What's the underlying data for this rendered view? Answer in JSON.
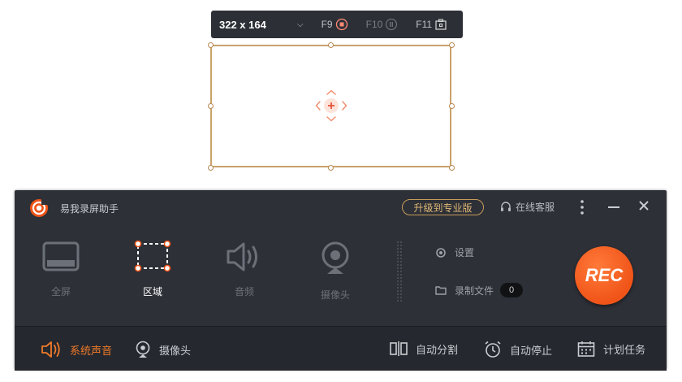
{
  "selection": {
    "size": "322 x 164",
    "hotkeys": [
      {
        "key": "F9",
        "icon": "stop-record-icon"
      },
      {
        "key": "F10",
        "icon": "pause-icon"
      },
      {
        "key": "F11",
        "icon": "screenshot-icon"
      }
    ]
  },
  "app": {
    "title": "易我录屏助手",
    "upgrade_label": "升级到专业版",
    "support_label": "在线客服"
  },
  "modes": [
    {
      "label": "全屏",
      "icon": "monitor-icon",
      "active": false
    },
    {
      "label": "区域",
      "icon": "region-select-icon",
      "active": true
    },
    {
      "label": "音频",
      "icon": "speaker-icon",
      "active": false
    },
    {
      "label": "摄像头",
      "icon": "webcam-icon",
      "active": false
    }
  ],
  "side": {
    "settings_label": "设置",
    "files_label": "录制文件",
    "files_count": "0"
  },
  "rec_label": "REC",
  "bottom": {
    "system_sound": "系统声音",
    "camera": "摄像头",
    "auto_split": "自动分割",
    "auto_stop": "自动停止",
    "schedule": "计划任务"
  },
  "colors": {
    "accent": "#f05418",
    "panel_bg": "#2d3037",
    "upgrade_gold": "#e0b876"
  }
}
